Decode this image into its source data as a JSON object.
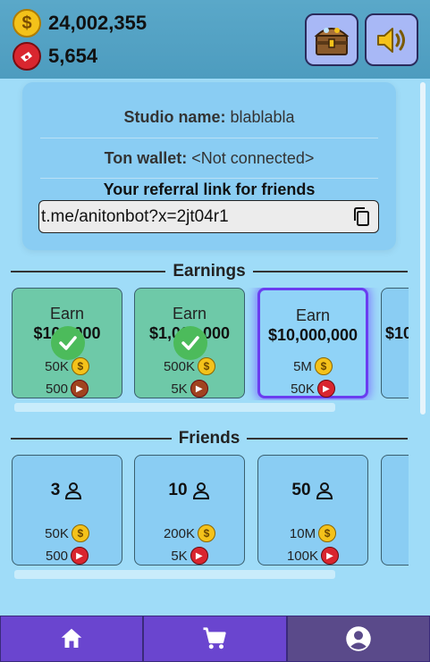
{
  "header": {
    "coins": "24,002,355",
    "tickets": "5,654",
    "buttons": [
      {
        "icon": "treasure-chest-icon"
      },
      {
        "icon": "speaker-icon"
      }
    ]
  },
  "profile": {
    "studio_label": "Studio name:",
    "studio_value": "blablabla",
    "wallet_label": "Ton wallet:",
    "wallet_value": "<Not connected>",
    "referral_title": "Your referral link for friends",
    "referral_link": "t.me/anitonbot?x=2jt04r1"
  },
  "earnings": {
    "title": "Earnings",
    "cards": [
      {
        "line1": "Earn",
        "line2": "$100,000",
        "coin_reward": "50K",
        "ticket_reward": "500",
        "state": "completed"
      },
      {
        "line1": "Earn",
        "line2": "$1,000,000",
        "coin_reward": "500K",
        "ticket_reward": "5K",
        "state": "completed"
      },
      {
        "line1": "Earn",
        "line2": "$10,000,000",
        "coin_reward": "5M",
        "ticket_reward": "50K",
        "state": "active"
      },
      {
        "line1": "",
        "line2": "$10",
        "coin_reward": "",
        "ticket_reward": "",
        "state": "locked"
      }
    ]
  },
  "friends": {
    "title": "Friends",
    "cards": [
      {
        "count": "3",
        "coin_reward": "50K",
        "ticket_reward": "500"
      },
      {
        "count": "10",
        "coin_reward": "200K",
        "ticket_reward": "5K"
      },
      {
        "count": "50",
        "coin_reward": "10M",
        "ticket_reward": "100K"
      },
      {
        "count": "",
        "coin_reward": "",
        "ticket_reward": ""
      }
    ]
  },
  "nav": [
    {
      "icon": "home-icon",
      "selected": false
    },
    {
      "icon": "cart-icon",
      "selected": false
    },
    {
      "icon": "profile-icon",
      "selected": true
    }
  ],
  "colors": {
    "background": "#9fdcf8",
    "topbar": "#5aa8c9",
    "completed": "#6ec9a8",
    "active_glow": "#6a3df0",
    "nav": "#6a45cf"
  }
}
